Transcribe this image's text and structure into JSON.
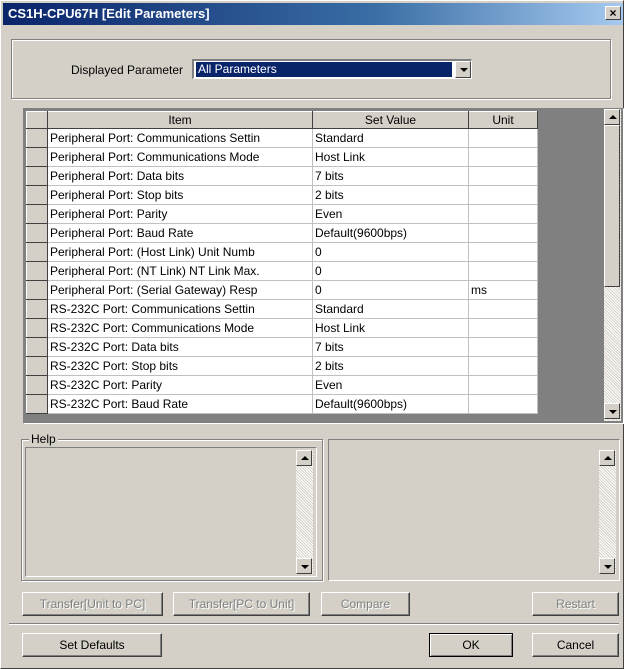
{
  "window": {
    "title": "CS1H-CPU67H [Edit Parameters]",
    "close_glyph": "×"
  },
  "displayed_parameter": {
    "label": "Displayed Parameter",
    "value": "All Parameters"
  },
  "table": {
    "headers": {
      "item": "Item",
      "set_value": "Set Value",
      "unit": "Unit"
    },
    "rows": [
      {
        "item": "Peripheral Port: Communications Settin",
        "value": "Standard",
        "unit": ""
      },
      {
        "item": "Peripheral Port: Communications Mode",
        "value": "Host Link",
        "unit": ""
      },
      {
        "item": "Peripheral Port: Data bits",
        "value": "7 bits",
        "unit": ""
      },
      {
        "item": "Peripheral Port: Stop bits",
        "value": "2 bits",
        "unit": ""
      },
      {
        "item": "Peripheral Port: Parity",
        "value": "Even",
        "unit": ""
      },
      {
        "item": "Peripheral Port: Baud Rate",
        "value": "Default(9600bps)",
        "unit": ""
      },
      {
        "item": "Peripheral Port:  (Host Link) Unit Numb",
        "value": "0",
        "unit": ""
      },
      {
        "item": "Peripheral Port: (NT Link) NT Link Max.",
        "value": "0",
        "unit": ""
      },
      {
        "item": "Peripheral Port: (Serial Gateway)  Resp",
        "value": "0",
        "unit": "ms"
      },
      {
        "item": "RS-232C Port: Communications Settin",
        "value": "Standard",
        "unit": ""
      },
      {
        "item": "RS-232C Port: Communications Mode",
        "value": "Host Link",
        "unit": ""
      },
      {
        "item": "RS-232C Port: Data bits",
        "value": "7 bits",
        "unit": ""
      },
      {
        "item": "RS-232C Port: Stop bits",
        "value": "2 bits",
        "unit": ""
      },
      {
        "item": "RS-232C Port: Parity",
        "value": "Even",
        "unit": ""
      },
      {
        "item": "RS-232C Port: Baud Rate",
        "value": "Default(9600bps)",
        "unit": ""
      }
    ]
  },
  "help": {
    "label": "Help"
  },
  "buttons": {
    "transfer_unit_to_pc": "Transfer[Unit to PC]",
    "transfer_pc_to_unit": "Transfer[PC to Unit]",
    "compare": "Compare",
    "restart": "Restart",
    "set_defaults": "Set Defaults",
    "ok": "OK",
    "cancel": "Cancel"
  }
}
